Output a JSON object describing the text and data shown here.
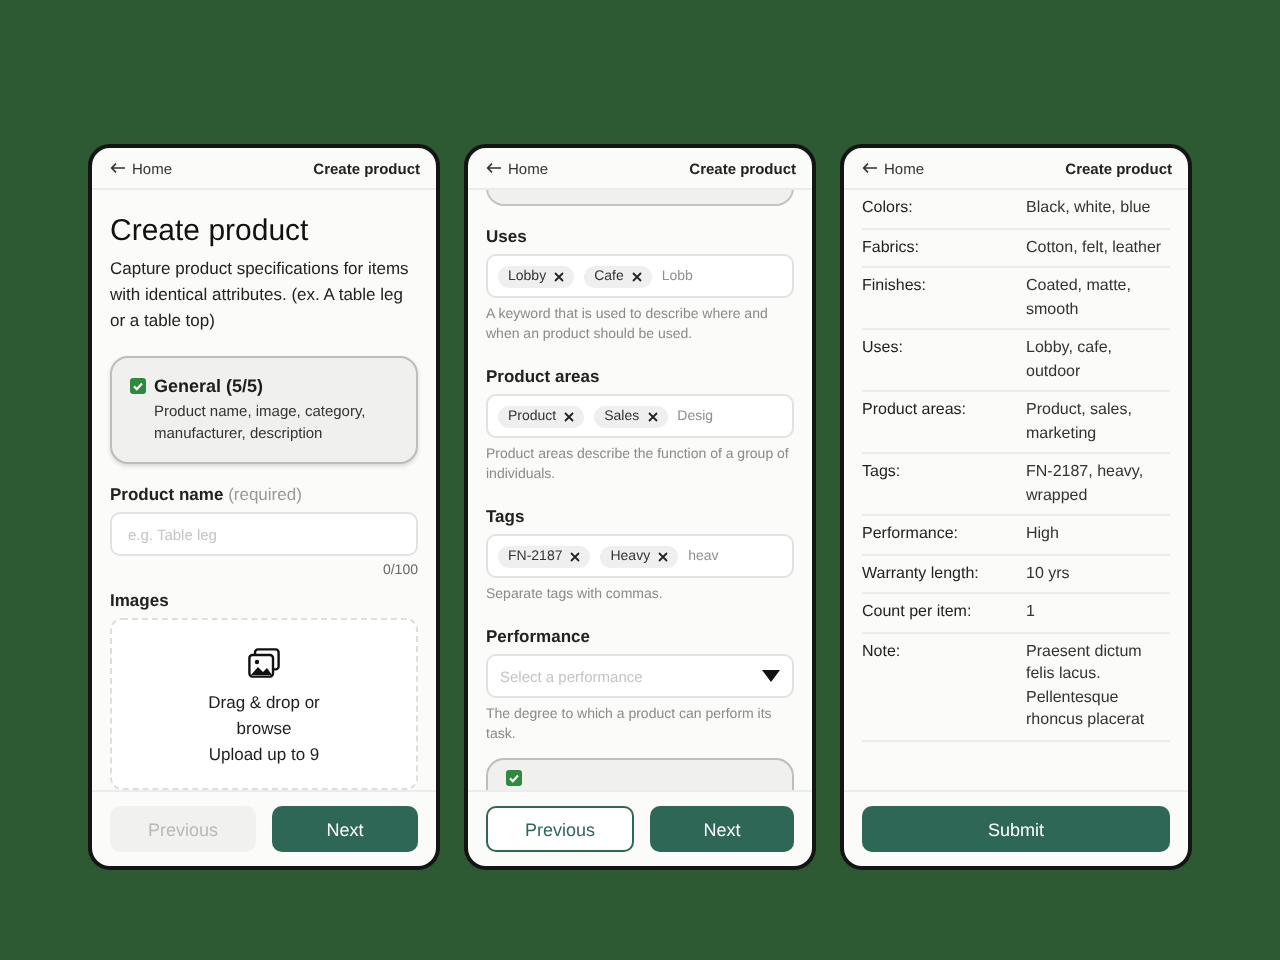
{
  "screens": [
    {
      "kind": "general",
      "header": {
        "back": "Home",
        "title": "Create product"
      },
      "heading": "Create product",
      "description": "Capture product specifications for items with identical attributes. (ex. A table leg or a table top)",
      "section_card": {
        "title": "General (5/5)",
        "subtitle": "Product name, image, category, manufacturer, description",
        "checked": true
      },
      "field": {
        "label": "Product name",
        "hint": "(required)",
        "placeholder": "e.g. Table leg",
        "counter": "0/100"
      },
      "images": {
        "label": "Images",
        "prompt": "Drag & drop or browse",
        "limit": "Upload up to 9"
      },
      "buttons": [
        {
          "kind": "previous",
          "label": "Previous",
          "disabled": true
        },
        {
          "kind": "next",
          "label": "Next",
          "disabled": false
        }
      ]
    },
    {
      "kind": "attributes",
      "header": {
        "back": "Home",
        "title": "Create product"
      },
      "fields": [
        {
          "kind": "tags",
          "label": "Uses",
          "tags": [
            "Lobby",
            "Cafe"
          ],
          "placeholder": "Lobb",
          "help": "A keyword that is used to describe where and when an product should be used."
        },
        {
          "kind": "tags",
          "label": "Product areas",
          "tags": [
            "Product",
            "Sales"
          ],
          "placeholder": "Desig",
          "help": "Product areas describe the function of a group of individuals."
        },
        {
          "kind": "tags",
          "label": "Tags",
          "tags": [
            "FN-2187",
            "Heavy"
          ],
          "placeholder": "heav",
          "help": "Separate tags with commas."
        },
        {
          "kind": "select",
          "label": "Performance",
          "placeholder": "Select a performance",
          "help": "The degree to which a product can perform its task."
        }
      ],
      "next_section": {
        "checked": true
      },
      "buttons": [
        {
          "kind": "previous",
          "label": "Previous",
          "disabled": false
        },
        {
          "kind": "next",
          "label": "Next",
          "disabled": false
        }
      ]
    },
    {
      "kind": "review",
      "header": {
        "back": "Home",
        "title": "Create product"
      },
      "rows": [
        {
          "label": "Colors:",
          "value": "Black, white, blue"
        },
        {
          "label": "Fabrics:",
          "value": "Cotton, felt, leather"
        },
        {
          "label": "Finishes:",
          "value": "Coated, matte, smooth"
        },
        {
          "label": "Uses:",
          "value": "Lobby, cafe, outdoor"
        },
        {
          "label": "Product areas:",
          "value": "Product, sales, marketing"
        },
        {
          "label": "Tags:",
          "value": "FN-2187, heavy, wrapped"
        },
        {
          "label": "Performance:",
          "value": "High"
        },
        {
          "label": "Warranty length:",
          "value": "10 yrs"
        },
        {
          "label": "Count per item:",
          "value": "1"
        },
        {
          "label": "Note:",
          "value": "Praesent dictum felis lacus. Pellentesque rhoncus placerat"
        }
      ],
      "buttons": [
        {
          "kind": "submit",
          "label": "Submit",
          "disabled": false
        }
      ]
    }
  ]
}
